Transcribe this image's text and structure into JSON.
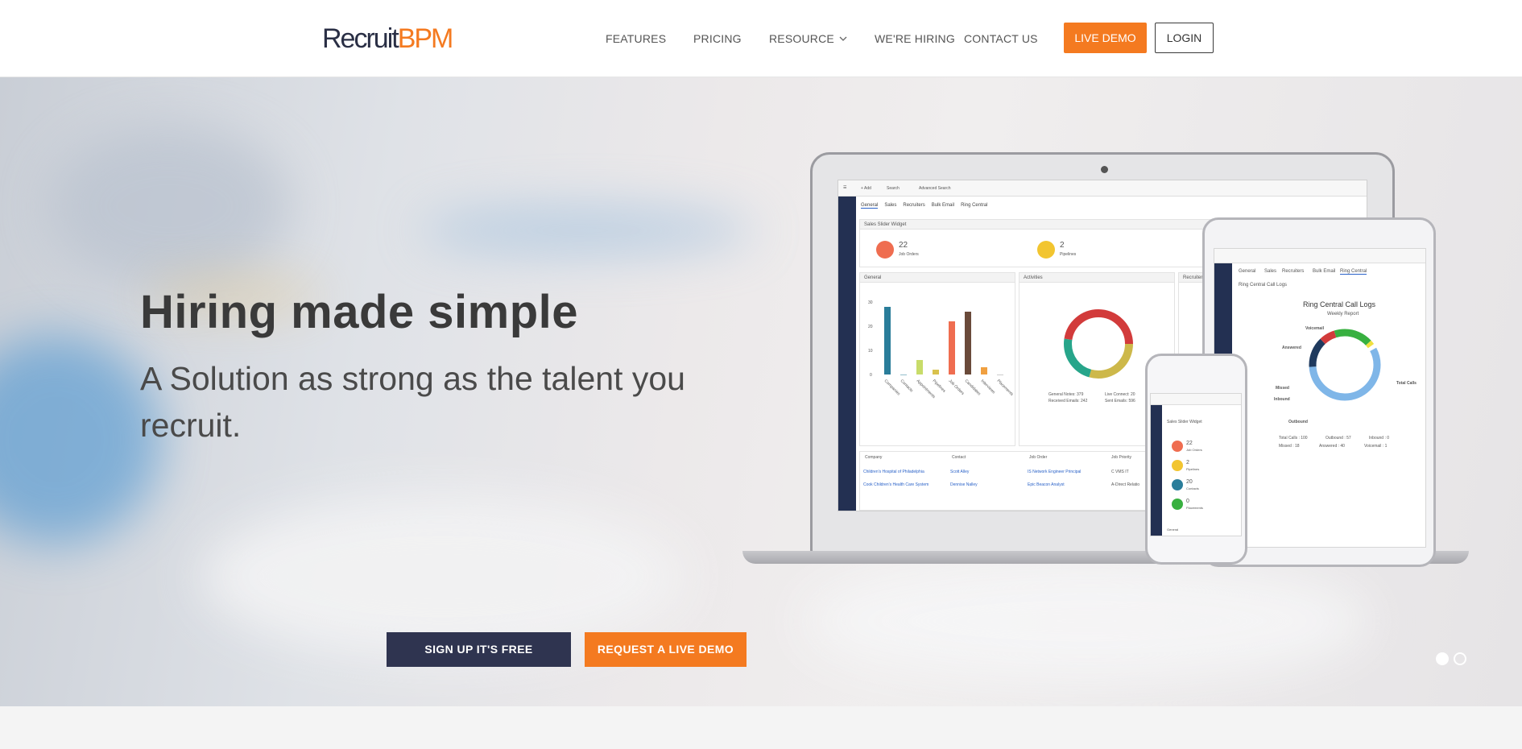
{
  "brand": {
    "logo_part1": "Recruit",
    "logo_part2": "BPM",
    "color_dark": "#2a2f45",
    "color_orange": "#f47a20"
  },
  "nav": {
    "items": [
      {
        "label": "FEATURES"
      },
      {
        "label": "PRICING"
      },
      {
        "label": "RESOURCE",
        "has_dropdown": true
      },
      {
        "label": "WE'RE HIRING"
      },
      {
        "label": "CONTACT US"
      }
    ],
    "live_demo_label": "LIVE DEMO",
    "login_label": "LOGIN"
  },
  "hero": {
    "title": "Hiring made simple",
    "subtitle": "A Solution as strong as the talent you recruit.",
    "signup_label": "SIGN UP IT'S FREE",
    "request_label": "REQUEST A LIVE DEMO",
    "carousel": {
      "slide_count": 2,
      "active_index": 0
    }
  },
  "dashboard": {
    "toolbar": [
      "+ Add",
      "Search",
      "Advanced Search"
    ],
    "tabs": [
      "General",
      "Sales",
      "Recruiters",
      "Bulk Email",
      "Ring Central"
    ],
    "widget_title": "Sales Slider Widget",
    "stat1_value": "22",
    "stat1_label": "Job Orders",
    "stat2_value": "2",
    "stat2_label": "Pipelines",
    "panel_general": "General",
    "panel_activities": "Activities",
    "panel_recruiters": "Recruiters",
    "bar_axis": [
      "30",
      "20",
      "10",
      "0"
    ],
    "bar_categories": [
      "Companies",
      "Contacts",
      "Appointments",
      "Pipelines",
      "Job Orders",
      "Candidates",
      "Interviews",
      "Placements"
    ],
    "bar_values": [
      28,
      0,
      6,
      2,
      22,
      26,
      3,
      0
    ],
    "bar_colors": [
      "#2a7d9a",
      "#2a7d9a",
      "#c8dc6a",
      "#d9c24d",
      "#ef6d50",
      "#6a4a3a",
      "#f0a040",
      "#999999"
    ],
    "donut_legend": [
      "General Notes: 379",
      "Live Connect: 20",
      "Received Emails: 242",
      "Sent Emails: 596"
    ],
    "table_headers": [
      "Company",
      "Contact",
      "Job Order",
      "Job Priority"
    ],
    "table_rows": [
      [
        "Children's Hospital of Philadelphia",
        "Scott Alley",
        "IS Network Engineer Principal",
        "C VMS IT"
      ],
      [
        "Cook Children's Health Care System",
        "Dennise Nalley",
        "Epic Beacon Analyst",
        "A-Direct Relatio"
      ]
    ]
  },
  "tablet": {
    "tabs": [
      "General",
      "Sales",
      "Recruiters",
      "Bulk Email",
      "Ring Central"
    ],
    "section_title": "Ring Central Call Logs",
    "chart_title": "Ring Central Call Logs",
    "chart_subtitle": "Weekly Report",
    "labels": [
      "Voicemail",
      "Answered",
      "Missed",
      "Inbound",
      "Outbound",
      "Total Calls"
    ],
    "legend": [
      "Total Calls : 100",
      "Outbound : 57",
      "Inbound : 0",
      "Missed : 18",
      "Answered : 40",
      "Voicemail : 1"
    ]
  },
  "phone": {
    "widget_title": "Sales Slider Widget",
    "stats": [
      {
        "value": "22",
        "label": "Job Orders"
      },
      {
        "value": "2",
        "label": "Pipelines"
      },
      {
        "value": "20",
        "label": "Contacts"
      },
      {
        "value": "0",
        "label": "Placements"
      }
    ],
    "footer_label": "General"
  }
}
